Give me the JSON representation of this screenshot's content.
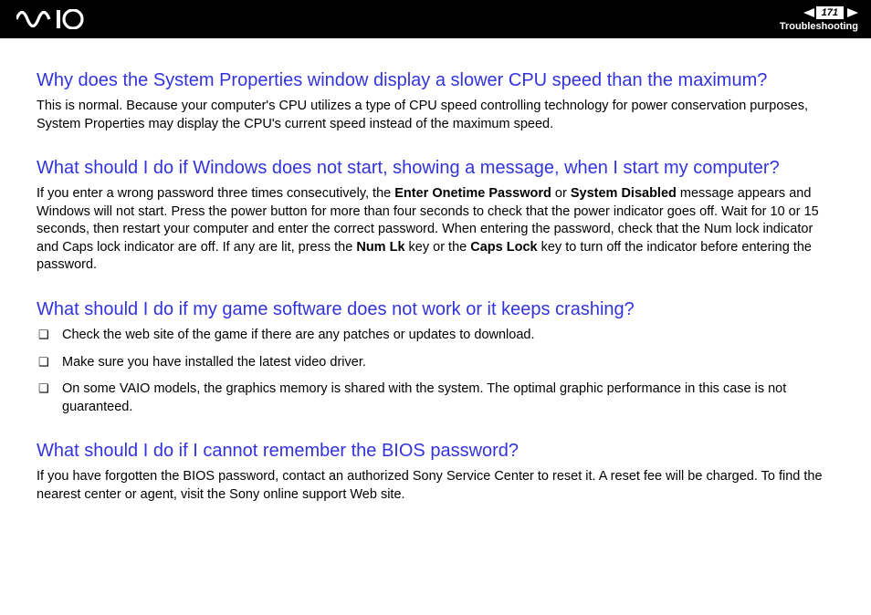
{
  "header": {
    "page_number": "171",
    "breadcrumb": "Troubleshooting"
  },
  "sections": [
    {
      "question": "Why does the System Properties window display a slower CPU speed than the maximum?",
      "answer_html": "This is normal. Because your computer's CPU utilizes a type of CPU speed controlling technology for power conservation purposes, System Properties may display the CPU's current speed instead of the maximum speed."
    },
    {
      "question": "What should I do if Windows does not start, showing a message, when I start my computer?",
      "answer_html": "If you enter a wrong password three times consecutively, the <b>Enter Onetime Password</b> or <b>System Disabled</b> message appears and Windows will not start. Press the power button for more than four seconds to check that the power indicator goes off. Wait for 10 or 15 seconds, then restart your computer and enter the correct password. When entering the password, check that the Num lock indicator and Caps lock indicator are off. If any are lit, press the <b>Num Lk</b> key or the <b>Caps Lock</b> key to turn off the indicator before entering the password."
    },
    {
      "question": "What should I do if my game software does not work or it keeps crashing?",
      "bullets": [
        "Check the web site of the game if there are any patches or updates to download.",
        "Make sure you have installed the latest video driver.",
        "On some VAIO models, the graphics memory is shared with the system. The optimal graphic performance in this case is not guaranteed."
      ]
    },
    {
      "question": "What should I do if I cannot remember the BIOS password?",
      "answer_html": "If you have forgotten the BIOS password, contact an authorized Sony Service Center to reset it. A reset fee will be charged. To find the nearest center or agent, visit the Sony online support Web site."
    }
  ]
}
